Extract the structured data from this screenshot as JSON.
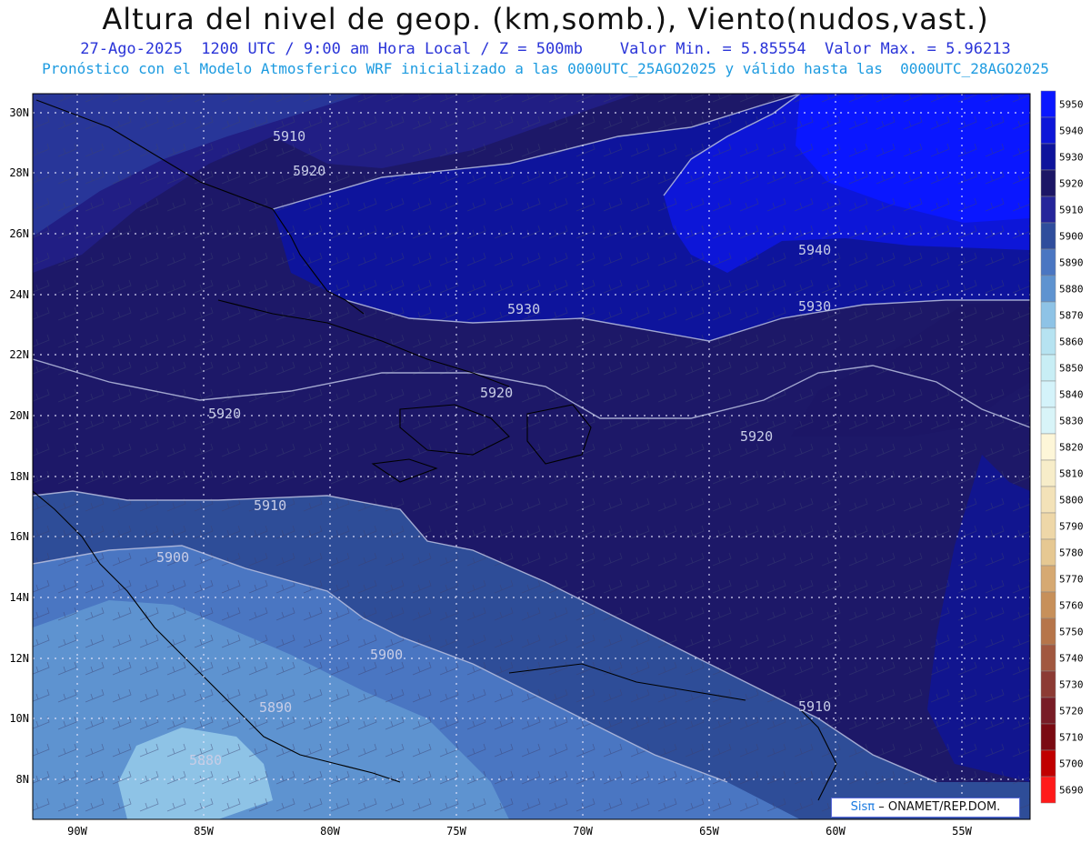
{
  "header": {
    "title": "Altura del nivel de geop. (km,somb.), Viento(nudos,vast.)",
    "line1": "27-Ago-2025  1200 UTC / 9:00 am Hora Local / Z = 500mb    Valor Min. = 5.85554  Valor Max. = 5.96213",
    "line2": "Pronóstico con el Modelo Atmosferico WRF inicializado a las 0000UTC_25AGO2025 y válido hasta las  0000UTC_28AGO2025"
  },
  "map": {
    "lat_ticks": [
      "30N",
      "28N",
      "26N",
      "24N",
      "22N",
      "20N",
      "18N",
      "16N",
      "14N",
      "12N",
      "10N",
      "8N"
    ],
    "lon_ticks": [
      "90W",
      "85W",
      "80W",
      "75W",
      "70W",
      "65W",
      "60W",
      "55W"
    ],
    "contour_labels": [
      {
        "text": "5910",
        "region": "upper-left"
      },
      {
        "text": "5920",
        "region": "upper-left"
      },
      {
        "text": "5940",
        "region": "upper-right"
      },
      {
        "text": "5930",
        "region": "center"
      },
      {
        "text": "5930",
        "region": "right"
      },
      {
        "text": "5920",
        "region": "center"
      },
      {
        "text": "5920",
        "region": "left"
      },
      {
        "text": "5920",
        "region": "right"
      },
      {
        "text": "5910",
        "region": "left"
      },
      {
        "text": "5900",
        "region": "left"
      },
      {
        "text": "5900",
        "region": "lower-center"
      },
      {
        "text": "5890",
        "region": "lower-left"
      },
      {
        "text": "5880",
        "region": "lower-left"
      },
      {
        "text": "5910",
        "region": "lower-right"
      }
    ]
  },
  "legend": {
    "levels": [
      "5950",
      "5940",
      "5930",
      "5920",
      "5910",
      "5900",
      "5890",
      "5880",
      "5870",
      "5860",
      "5850",
      "5840",
      "5830",
      "5820",
      "5810",
      "5800",
      "5790",
      "5780",
      "5770",
      "5760",
      "5750",
      "5740",
      "5730",
      "5720",
      "5710",
      "5700",
      "5690"
    ],
    "colors": [
      "#0a17ff",
      "#0d16d8",
      "#0e149c",
      "#1c1666",
      "#25259a",
      "#2f4d9c",
      "#4a76c2",
      "#5e93d0",
      "#8ec3e6",
      "#b6e3f1",
      "#c8eef5",
      "#d4f3fa",
      "#d8f4f8",
      "#fdf6d8",
      "#f7edc9",
      "#f3e2b8",
      "#eed7a8",
      "#e6c892",
      "#d6a972",
      "#c7905a",
      "#b6754a",
      "#a15840",
      "#8c3b34",
      "#781c26",
      "#7a0a12",
      "#c00000",
      "#ff1a1a"
    ]
  },
  "credit": {
    "brand": "Sisπ",
    "text": "– ONAMET/REP.DOM."
  }
}
